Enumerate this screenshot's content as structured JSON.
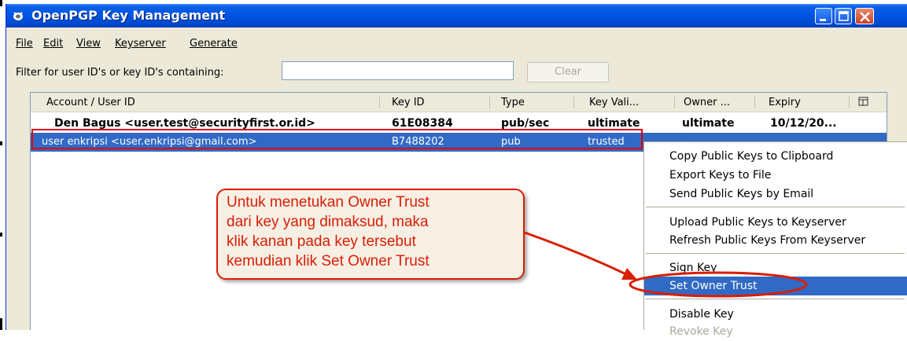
{
  "window": {
    "title": "OpenPGP Key Management",
    "icon": "openpgp-app-icon",
    "controls": [
      "minimize-icon",
      "maximize-icon",
      "close-icon"
    ]
  },
  "menu": {
    "file": "File",
    "edit": "Edit",
    "view": "View",
    "keyserver": "Keyserver",
    "generate": "Generate"
  },
  "filter": {
    "label": "Filter for user ID's or key ID's containing:",
    "value": "",
    "clear_label": "Clear"
  },
  "table": {
    "columns": [
      "Account / User ID",
      "Key ID",
      "Type",
      "Key Vali...",
      "Owner ...",
      "Expiry"
    ],
    "column_picker_icon": "column-picker-icon",
    "rows": [
      {
        "user": "Den Bagus <user.test@securityfirst.or.id>",
        "key_id": "61E08384",
        "type": "pub/sec",
        "validity": "ultimate",
        "owner": "ultimate",
        "expiry": "10/12/20..."
      },
      {
        "user": "user enkripsi <user.enkripsi@gmail.com>",
        "key_id": "B7488202",
        "type": "pub",
        "validity": "trusted",
        "owner": "-",
        "expiry": ""
      }
    ]
  },
  "context_menu": {
    "copy": "Copy Public Keys to Clipboard",
    "export": "Export Keys to File",
    "send": "Send Public Keys by Email",
    "upload": "Upload Public Keys to Keyserver",
    "refresh": "Refresh Public Keys From Keyserver",
    "sign": "Sign Key",
    "set_owner_trust": "Set Owner Trust",
    "disable": "Disable Key",
    "revoke": "Revoke Key"
  },
  "annotation": {
    "lines": [
      "Untuk menetukan Owner Trust",
      "dari key yang dimaksud, maka",
      "klik kanan pada key tersebut",
      "kemudian klik Set Owner Trust"
    ],
    "color": "#d81e05"
  },
  "colors": {
    "titlebar": "#0054e3",
    "selection": "#316ac5",
    "annotation": "#d81e05",
    "window_bg": "#ece9d8"
  }
}
